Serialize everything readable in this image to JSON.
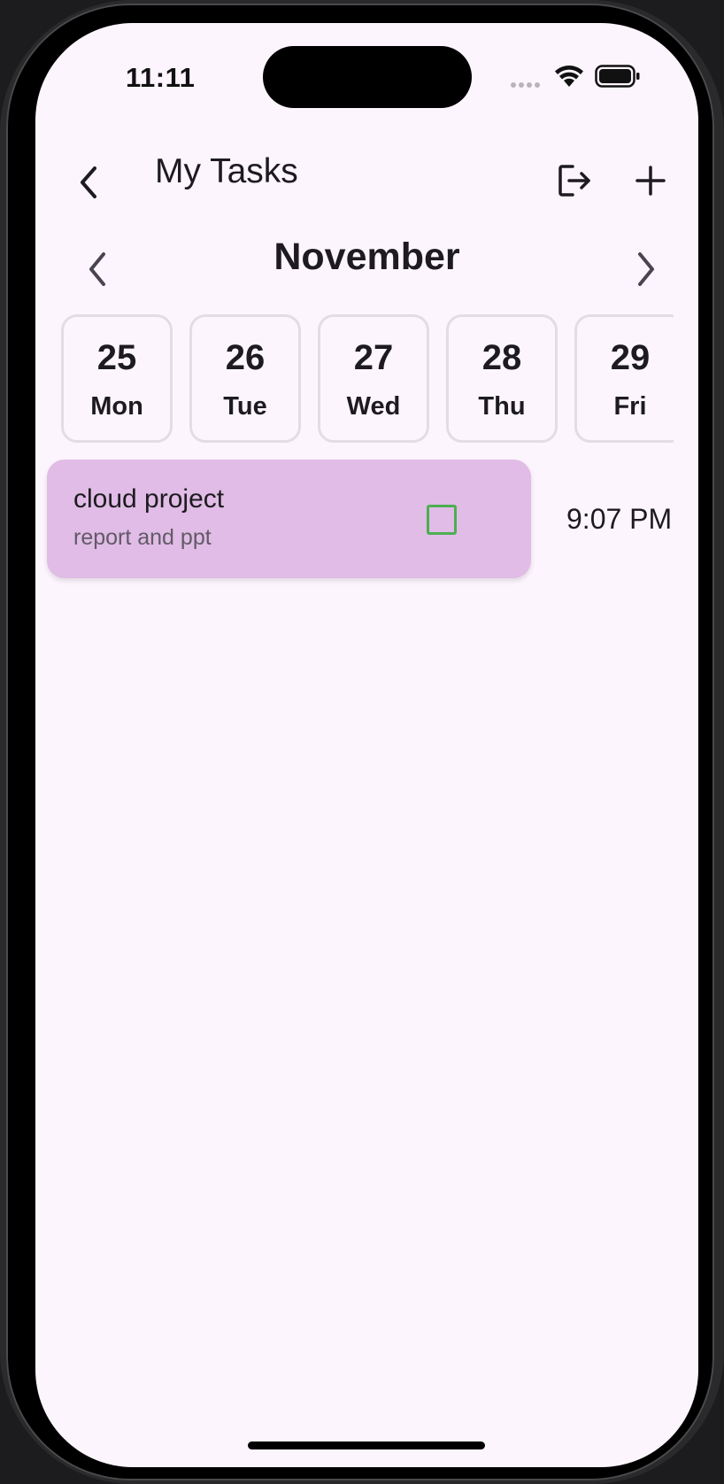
{
  "status_bar": {
    "time": "11:11"
  },
  "app_bar": {
    "title": "My Tasks",
    "icons": {
      "back": "chevron-left-icon",
      "logout": "logout-icon",
      "add": "plus-icon"
    }
  },
  "month_nav": {
    "month": "November",
    "icons": {
      "prev": "chevron-left-icon",
      "next": "chevron-right-icon"
    }
  },
  "days": [
    {
      "number": "25",
      "name": "Mon"
    },
    {
      "number": "26",
      "name": "Tue"
    },
    {
      "number": "27",
      "name": "Wed"
    },
    {
      "number": "28",
      "name": "Thu"
    },
    {
      "number": "29",
      "name": "Fri"
    }
  ],
  "tasks": [
    {
      "title": "cloud project",
      "subtitle": "report and ppt",
      "time": "9:07 PM",
      "completed": false
    }
  ],
  "colors": {
    "background": "#fdf5fd",
    "task_card": "#e0bce6",
    "checkbox": "#4caf50",
    "day_card_border": "#e2dde3"
  }
}
